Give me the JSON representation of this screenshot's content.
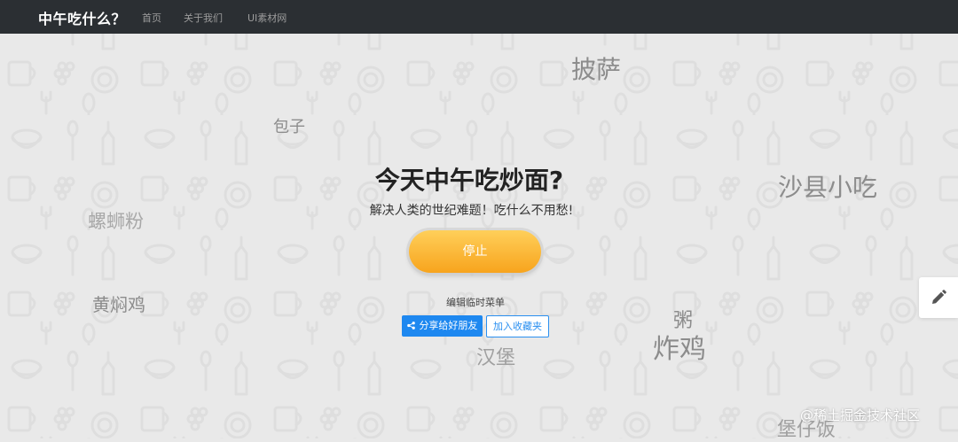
{
  "navbar": {
    "brand": "中午吃什么？",
    "links": [
      "首页",
      "关于我们",
      "UI素材网"
    ]
  },
  "main": {
    "title": "今天中午吃炒面?",
    "subtitle": "解决人类的世纪难题！吃什么不用愁!",
    "stop_button": "停止",
    "edit_menu_link": "编辑临时菜单",
    "share_button": "分享给好朋友",
    "favorite_button": "加入收藏夹"
  },
  "floating_words": [
    "披萨",
    "包子",
    "沙县小吃",
    "螺蛳粉",
    "黄焖鸡",
    "粥",
    "炸鸡",
    "汉堡",
    "堡仔饭"
  ],
  "watermark": "@稀土掘金技术社区",
  "colors": {
    "navbar_bg": "#2b2f33",
    "page_bg": "#e9e9e9",
    "stop_button_top": "#ffcf5a",
    "stop_button_bottom": "#f7a41d",
    "share_button_bg": "#1e88f0",
    "favorite_button_border": "#2a8ff0"
  },
  "icons": {
    "share": "share-icon",
    "edit": "pencil-icon"
  }
}
